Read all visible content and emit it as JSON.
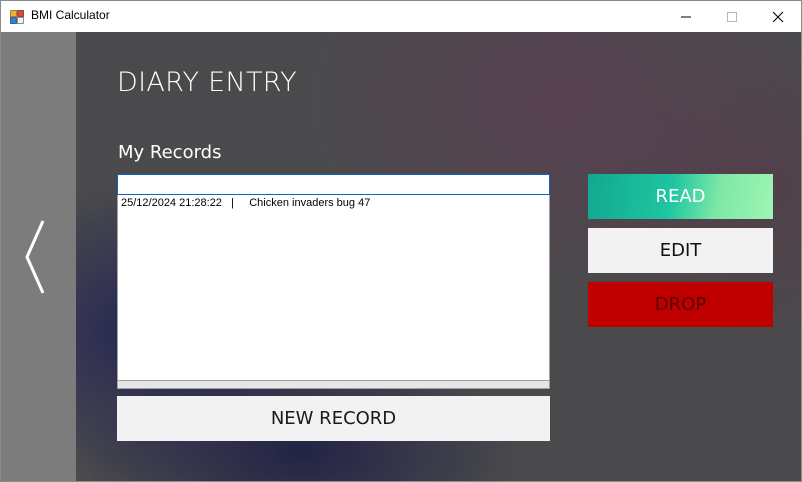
{
  "window": {
    "title": "BMI Calculator",
    "icon": "app-grid-icon",
    "controls": [
      "minimize-icon",
      "maximize-icon",
      "close-icon"
    ]
  },
  "page": {
    "title": "DIARY ENTRY",
    "section_label": "My Records"
  },
  "search": {
    "value": "",
    "placeholder": ""
  },
  "records": [
    "25/12/2024 21:28:22   |     Chicken invaders bug 47"
  ],
  "buttons": {
    "new_record": "NEW RECORD",
    "read": "READ",
    "edit": "EDIT",
    "drop": "DROP"
  },
  "colors": {
    "drop": "#c00000",
    "read_gradient_start": "#12a890",
    "read_gradient_end": "#9ef5b3",
    "side_strip": "#7c7c7c"
  },
  "nav": {
    "back_icon": "chevron-left-icon"
  }
}
